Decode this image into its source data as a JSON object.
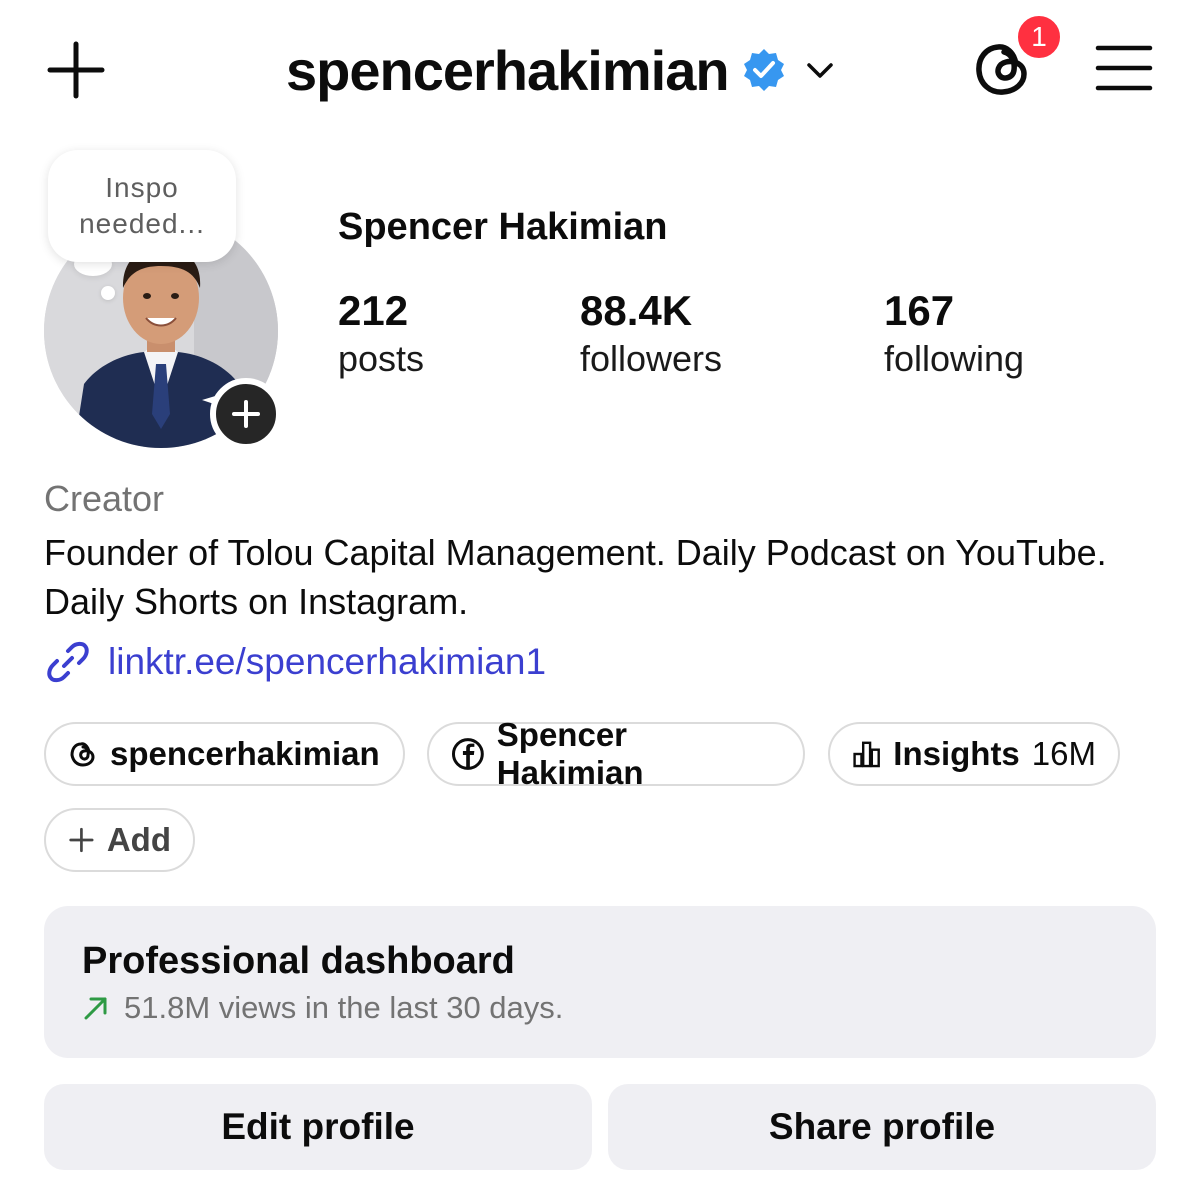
{
  "header": {
    "username": "spencerhakimian",
    "notification_count": "1"
  },
  "note": {
    "text_line1": "Inspo",
    "text_line2": "needed..."
  },
  "profile": {
    "full_name": "Spencer Hakimian",
    "stats": [
      {
        "value": "212",
        "label": "posts"
      },
      {
        "value": "88.4K",
        "label": "followers"
      },
      {
        "value": "167",
        "label": "following"
      }
    ],
    "category": "Creator",
    "bio": "Founder of Tolou Capital Management. Daily Podcast on YouTube. Daily Shorts on Instagram.",
    "link": "linktr.ee/spencerhakimian1"
  },
  "chips": {
    "threads_label": "spencerhakimian",
    "facebook_label": "Spencer Hakimian",
    "insights_label": "Insights",
    "insights_value": "16M",
    "add_label": "Add"
  },
  "dashboard": {
    "title": "Professional dashboard",
    "subtitle": "51.8M views in the last 30 days."
  },
  "buttons": {
    "edit": "Edit profile",
    "share": "Share profile"
  },
  "colors": {
    "verified_blue": "#3797f0",
    "link_blue": "#3b3fd0",
    "badge_red": "#ff3040",
    "trend_green": "#2e9a44",
    "chip_border": "#dbdbdb",
    "panel_bg": "#efeff3"
  }
}
